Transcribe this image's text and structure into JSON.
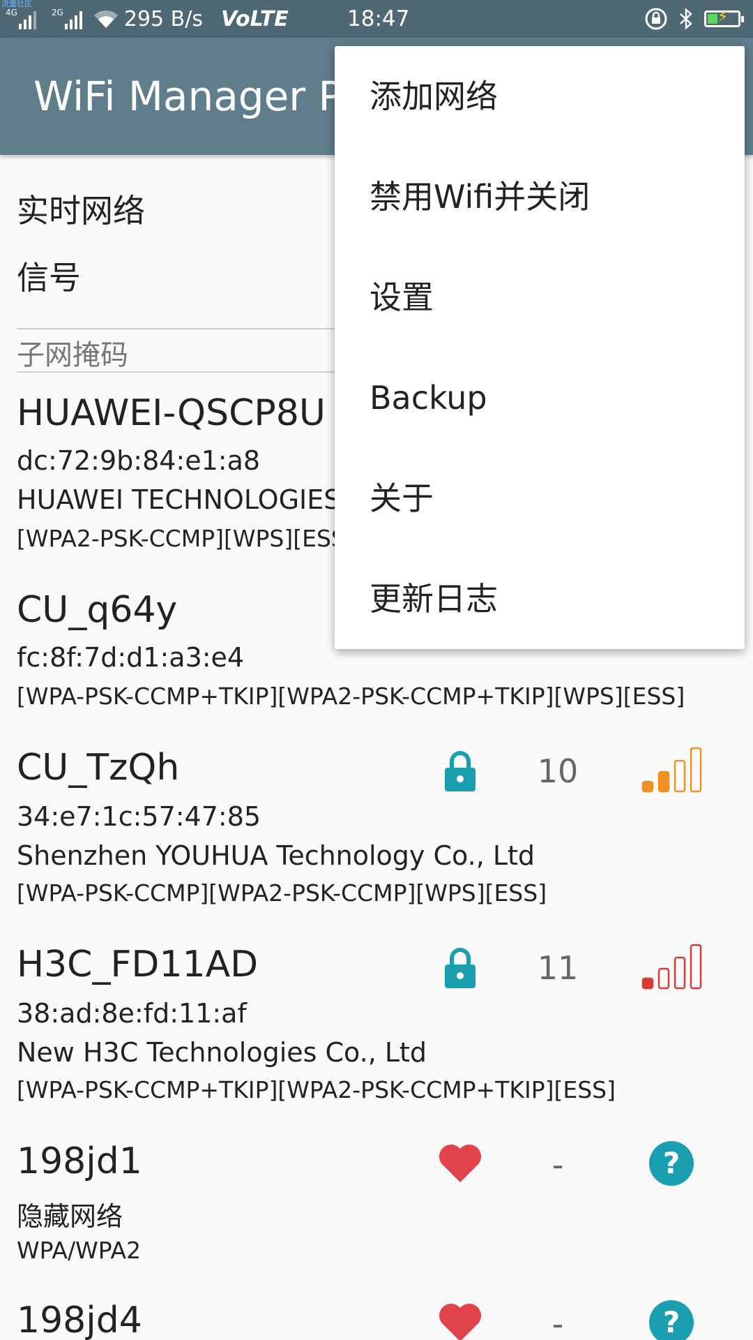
{
  "statusbar": {
    "carrier": "流量社区",
    "net1": "4G",
    "net2": "2G",
    "speed": "295 B/s",
    "volte": "VoLTE",
    "time": "18:47"
  },
  "toolbar": {
    "title": "WiFi Manager Pro"
  },
  "header": {
    "realtime_label": "实时网络",
    "signal_label": "信号",
    "subnet_label": "子网掩码"
  },
  "networks": [
    {
      "name": "HUAWEI-QSCP8U",
      "mac": "dc:72:9b:84:e1:a8",
      "vendor": "HUAWEI TECHNOLOGIES CO.,LTD",
      "security": "[WPA2-PSK-CCMP][WPS][ESS]"
    },
    {
      "name": "CU_q64y",
      "mac": "fc:8f:7d:d1:a3:e4",
      "security": "[WPA-PSK-CCMP+TKIP][WPA2-PSK-CCMP+TKIP][WPS][ESS]"
    },
    {
      "name": "CU_TzQh",
      "mac": "34:e7:1c:57:47:85",
      "vendor": "Shenzhen YOUHUA Technology Co., Ltd",
      "security": "[WPA-PSK-CCMP][WPA2-PSK-CCMP][WPS][ESS]",
      "channel": "10",
      "signal_bars": 2,
      "signal_color": "#f0901e",
      "icon": "lock-icon"
    },
    {
      "name": "H3C_FD11AD",
      "mac": "38:ad:8e:fd:11:af",
      "vendor": "New H3C Technologies Co., Ltd",
      "security": "[WPA-PSK-CCMP+TKIP][WPA2-PSK-CCMP+TKIP][ESS]",
      "channel": "11",
      "signal_bars": 1,
      "signal_color": "#d83a3a",
      "icon": "lock-icon"
    },
    {
      "name": "198jd1",
      "hidden_label": "隐藏网络",
      "security": "WPA/WPA2",
      "channel": "-",
      "icon": "heart-icon",
      "status_icon": "question-icon"
    },
    {
      "name": "198jd4",
      "channel": "-",
      "icon": "heart-icon",
      "status_icon": "question-icon"
    }
  ],
  "menu": {
    "items": [
      "添加网络",
      "禁用Wifi并关闭",
      "设置",
      "Backup",
      "关于",
      "更新日志"
    ]
  },
  "colors": {
    "toolbar": "#607d8b",
    "statusbar": "#4f6876",
    "lock": "#1a9fb0",
    "heart": "#e0434b",
    "question": "#1a9fb0"
  }
}
